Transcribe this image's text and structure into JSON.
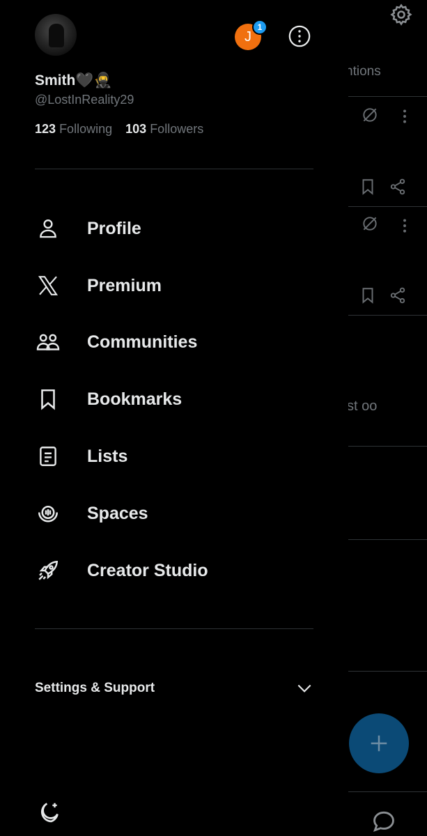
{
  "background": {
    "tab_partial": "ntions",
    "snippet_partial": "st oo"
  },
  "profile": {
    "name": "Smith🖤🥷",
    "handle": "@LostInReality29",
    "following_count": "123",
    "following_label": "Following",
    "followers_count": "103",
    "followers_label": "Followers"
  },
  "account_switcher": {
    "initial": "J",
    "badge_count": "1"
  },
  "menu": [
    {
      "label": "Profile",
      "icon": "person-icon"
    },
    {
      "label": "Premium",
      "icon": "x-logo-icon"
    },
    {
      "label": "Communities",
      "icon": "communities-icon"
    },
    {
      "label": "Bookmarks",
      "icon": "bookmark-icon"
    },
    {
      "label": "Lists",
      "icon": "list-icon"
    },
    {
      "label": "Spaces",
      "icon": "spaces-icon"
    },
    {
      "label": "Creator Studio",
      "icon": "rocket-icon"
    }
  ],
  "settings": {
    "label": "Settings & Support"
  },
  "colors": {
    "background": "#000000",
    "text_primary": "#e7e9ea",
    "text_secondary": "#71767b",
    "divider": "#2f3336",
    "accent_blue": "#1d9bf0",
    "account_avatar": "#f0700f",
    "fab": "#0b4a76"
  }
}
